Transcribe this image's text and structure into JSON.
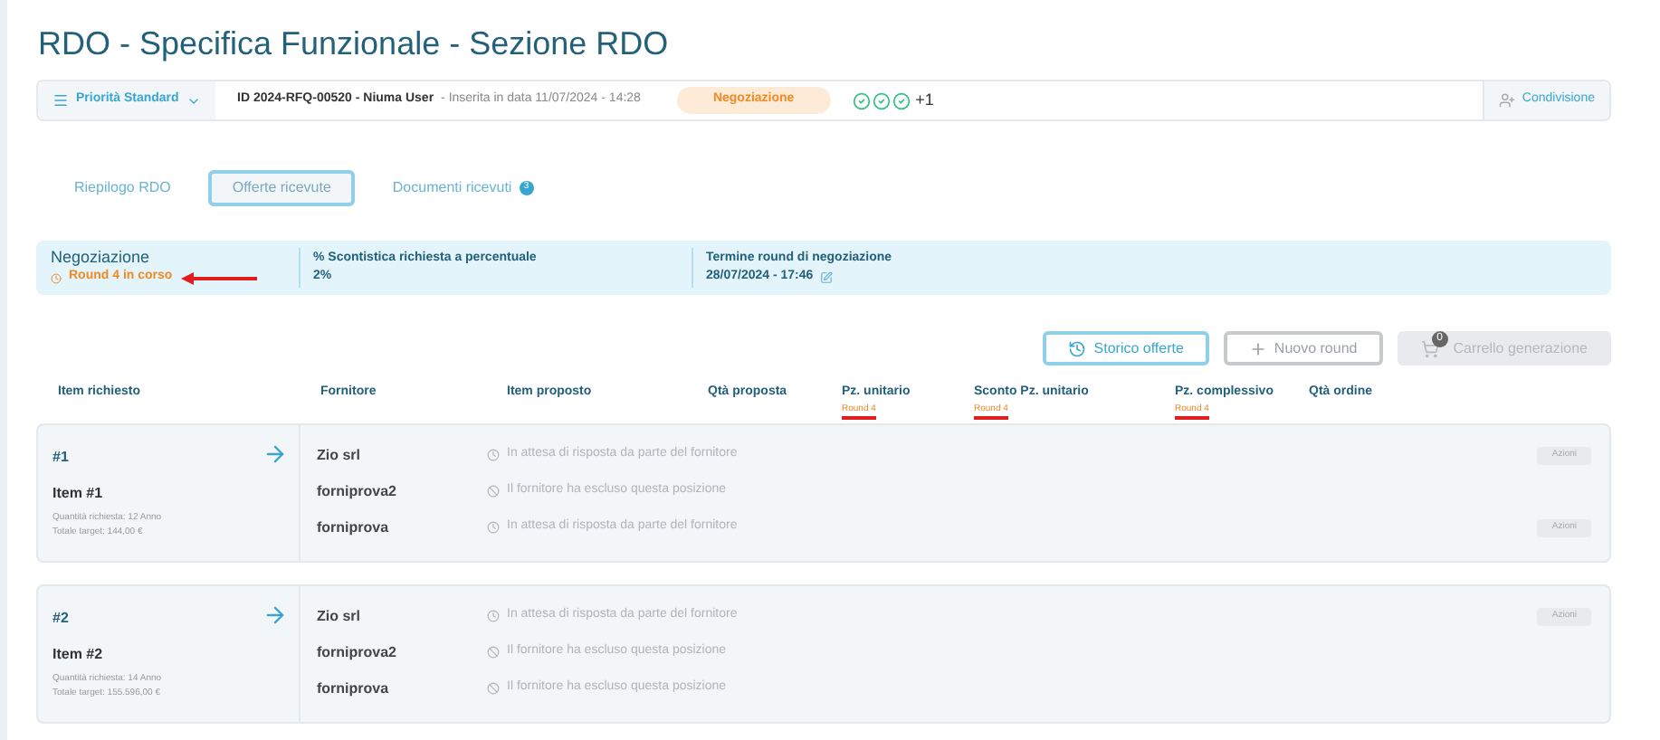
{
  "page_title": "RDO - Specifica Funzionale - Sezione RDO",
  "header": {
    "priority": "Priorità Standard",
    "id": "ID 2024-RFQ-00520 - Niuma User",
    "inserted": "- Inserita in data 11/07/2024 - 14:28",
    "status_badge": "Negoziazione",
    "approvals": [
      {
        "done": true
      },
      {
        "done": true
      },
      {
        "done": true
      }
    ],
    "more": "+1",
    "share": "Condivisione"
  },
  "tabs": [
    {
      "label": "Riepilogo RDO",
      "selected": false
    },
    {
      "label": "Offerte ricevute",
      "selected": true
    },
    {
      "label": "Documenti ricevuti",
      "selected": false,
      "badge": "3"
    }
  ],
  "info": {
    "phase": "Negoziazione",
    "round_status": "Round 4 in corso",
    "highlighted": true,
    "fields": [
      {
        "label": "% Scontistica richiesta a percentuale",
        "value": "2%",
        "editable": false
      },
      {
        "label": "Termine round di negoziazione",
        "value": "28/07/2024 - 17:46",
        "editable": true
      }
    ]
  },
  "actions": [
    {
      "label": "Storico offerte",
      "kind": "history",
      "disabled": false
    },
    {
      "label": "Nuovo round",
      "kind": "add",
      "disabled": false
    },
    {
      "label": "Carrello generazione",
      "kind": "cart",
      "disabled": true,
      "count": "0"
    }
  ],
  "columns": [
    {
      "label": "Item richiesto"
    },
    {
      "label": "Fornitore"
    },
    {
      "label": "Item proposto"
    },
    {
      "label": "Qtà proposta"
    },
    {
      "label": "Pz. unitario",
      "sub": "Round 4",
      "highlighted": true
    },
    {
      "label": "Sconto Pz. unitario",
      "sub": "Round 4",
      "highlighted": true
    },
    {
      "label": "Pz. complessivo",
      "sub": "Round 4",
      "highlighted": true
    },
    {
      "label": "Qtà ordine"
    }
  ],
  "items": [
    {
      "number": "#1",
      "name": "Item #1",
      "quantity": "Quantità richiesta: 12 Anno",
      "target": "Totale target: 144,00 €",
      "suppliers": [
        {
          "name": "Zio srl",
          "status": "In attesa di risposta da parte del fornitore",
          "kind": "waiting",
          "action": "Azioni"
        },
        {
          "name": "forniprova2",
          "status": "Il fornitore ha escluso questa posizione",
          "kind": "excluded"
        },
        {
          "name": "forniprova",
          "status": "In attesa di risposta da parte del fornitore",
          "kind": "waiting",
          "action": "Azioni"
        }
      ]
    },
    {
      "number": "#2",
      "name": "Item #2",
      "quantity": "Quantità richiesta: 14 Anno",
      "target": "Totale target: 155.596,00 €",
      "suppliers": [
        {
          "name": "Zio srl",
          "status": "In attesa di risposta da parte del fornitore",
          "kind": "waiting",
          "action": "Azioni"
        },
        {
          "name": "forniprova2",
          "status": "Il fornitore ha escluso questa posizione",
          "kind": "excluded"
        },
        {
          "name": "forniprova",
          "status": "Il fornitore ha escluso questa posizione",
          "kind": "excluded"
        }
      ]
    }
  ]
}
